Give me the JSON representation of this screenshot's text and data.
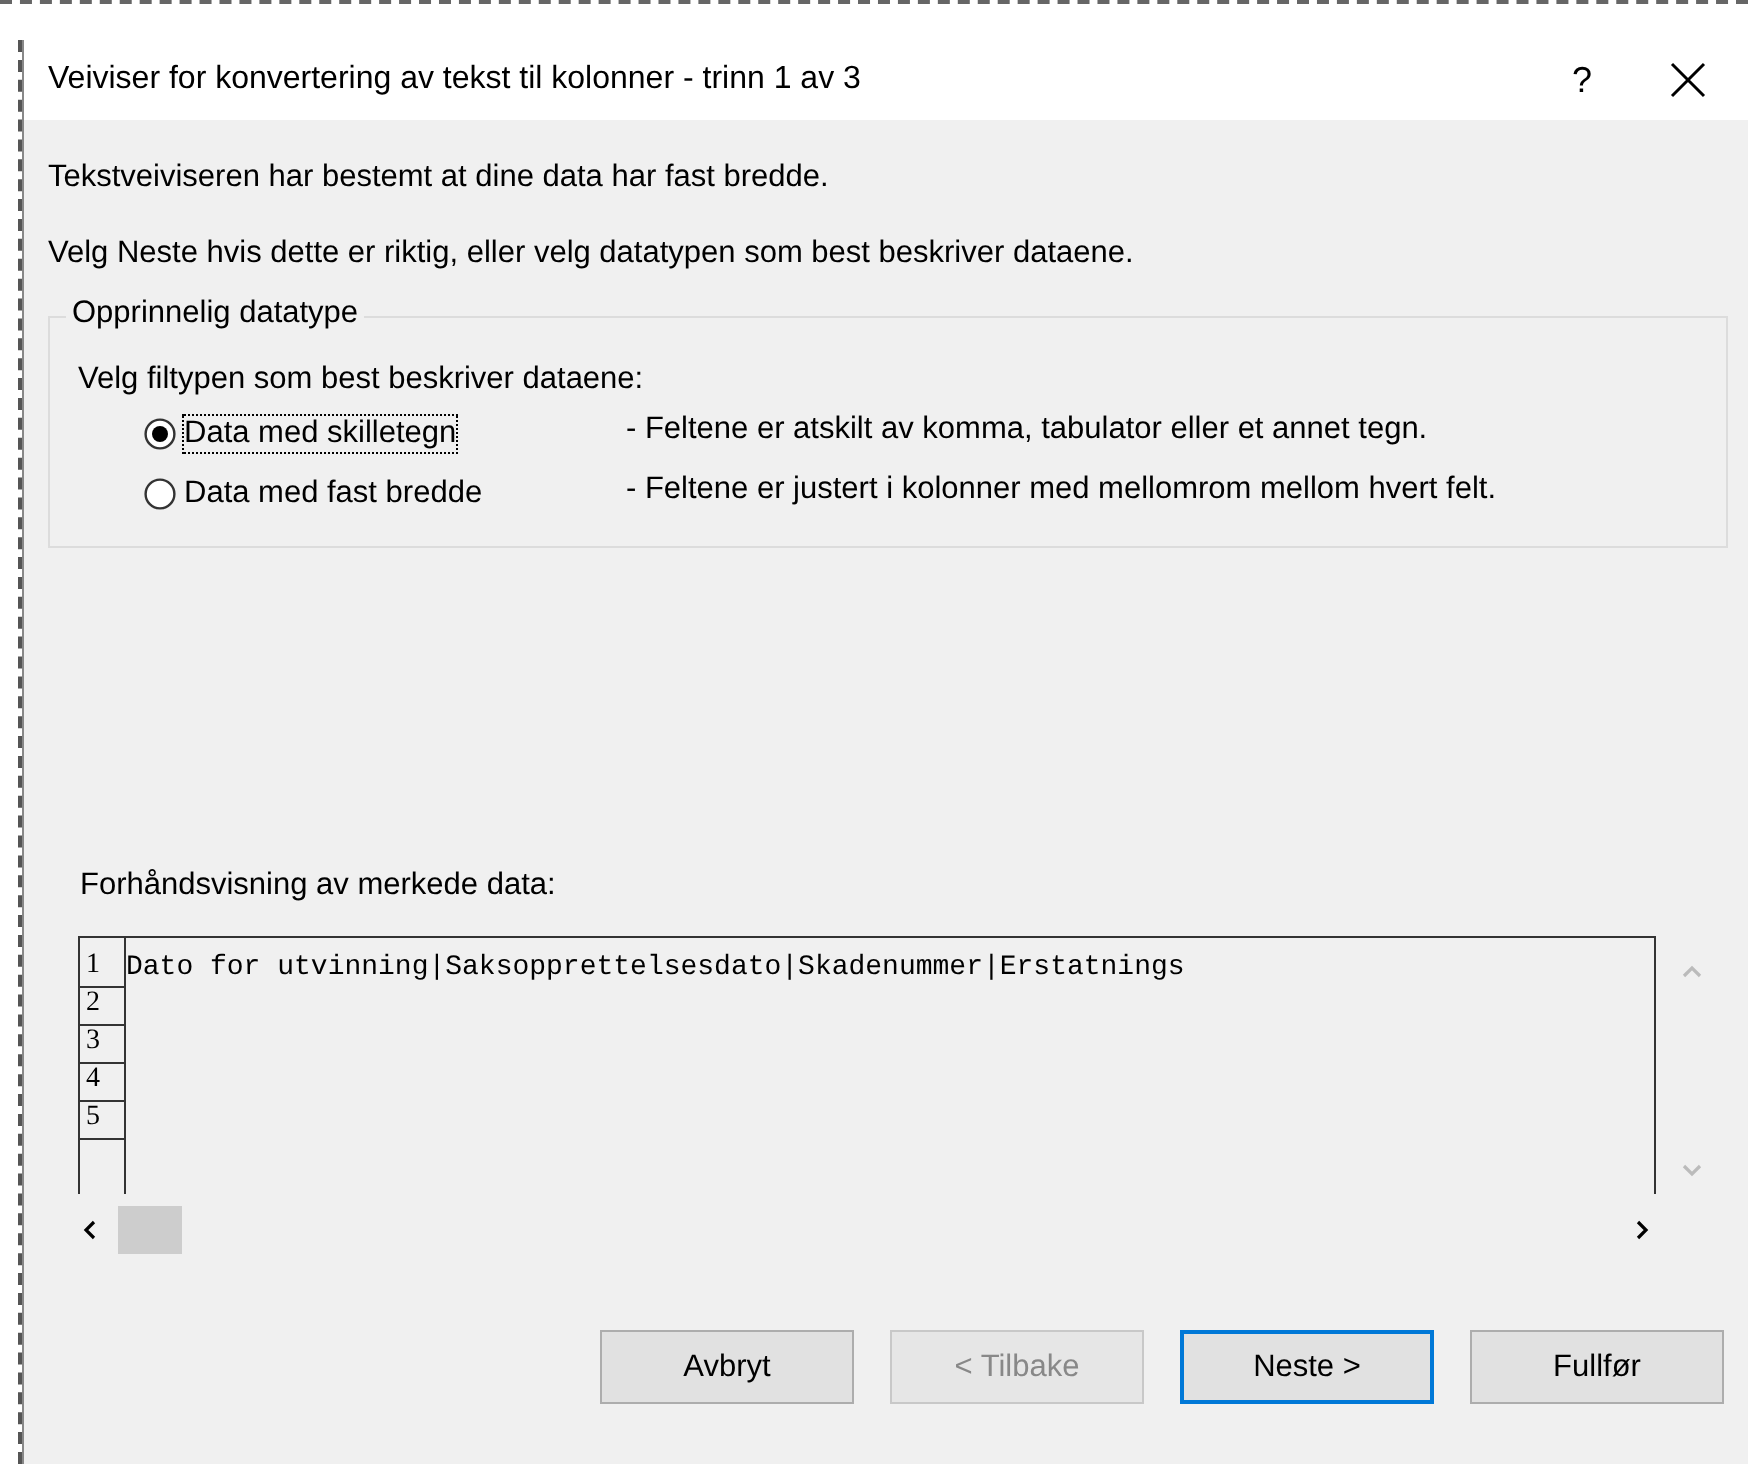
{
  "window": {
    "title": "Veiviser for konvertering av tekst til kolonner - trinn 1 av 3",
    "help": "?"
  },
  "intro": [
    "Tekstveiviseren har bestemt at dine data har fast bredde.",
    "Velg Neste hvis dette er riktig, eller velg datatypen som best beskriver dataene."
  ],
  "group": {
    "legend": "Opprinnelig datatype",
    "prompt": "Velg filtypen som best beskriver dataene:",
    "options": [
      {
        "label": "Data med skilletegn",
        "description": "- Feltene er atskilt av komma, tabulator eller et annet tegn.",
        "selected": true,
        "focused": true
      },
      {
        "label": "Data med fast bredde",
        "description": "- Feltene er justert i kolonner med mellomrom mellom hvert felt.",
        "selected": false,
        "focused": false
      }
    ]
  },
  "preview": {
    "label": "Forhåndsvisning av merkede data:",
    "rows": [
      {
        "number": "1",
        "text": "Dato for utvinning|Saksopprettelsesdato|Skadenummer|Erstatnings"
      },
      {
        "number": "2"
      },
      {
        "number": "3"
      },
      {
        "number": "4"
      },
      {
        "number": "5"
      }
    ]
  },
  "buttons": [
    {
      "label": "Avbryt",
      "disabled": false,
      "default": false
    },
    {
      "label": "< Tilbake",
      "disabled": true,
      "default": false
    },
    {
      "label": "Neste >",
      "disabled": false,
      "default": true
    },
    {
      "label": "Fullfør",
      "disabled": false,
      "default": false
    }
  ]
}
